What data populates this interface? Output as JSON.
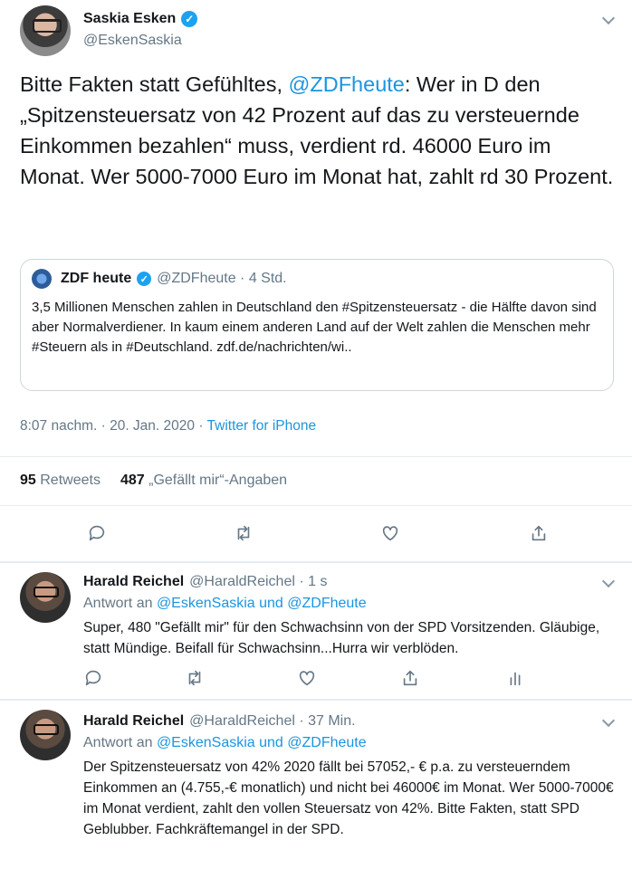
{
  "main_tweet": {
    "author_name": "Saskia Esken",
    "author_handle": "@EskenSaskia",
    "text_before_mention": "Bitte Fakten statt Gefühltes, ",
    "mention": "@ZDFheute",
    "text_after_mention": ": Wer in D den „Spitzensteuersatz von 42 Prozent auf das zu versteuernde Einkommen bezahlen“ muss, verdient rd. 46000 Euro im Monat. Wer 5000-7000 Euro im Monat hat, zahlt rd 30 Prozent.",
    "quoted": {
      "name": "ZDF heute",
      "handle_time": "@ZDFheute · 4 Std.",
      "text": "3,5 Millionen Menschen zahlen in Deutschland den #Spitzensteuersatz - die Hälfte davon sind aber Normalverdiener. In kaum einem anderen Land  auf der Welt zahlen die Menschen mehr #Steuern als in #Deutschland. zdf.de/nachrichten/wi.."
    },
    "timestamp": "8:07 nachm. · 20. Jan. 2020 · ",
    "source": "Twitter for iPhone",
    "retweets_count": "95",
    "retweets_label": "Retweets",
    "likes_count": "487",
    "likes_label": "„Gefällt mir“-Angaben",
    "verified_mark": "✓"
  },
  "icons": [
    "reply-icon",
    "retweet-icon",
    "like-icon",
    "share-icon",
    "analytics-icon",
    "chevron-down-icon",
    "verified-icon"
  ],
  "replies": [
    {
      "author_name": "Harald Reichel",
      "handle_time": "@HaraldReichel · 1 s",
      "reply_to_prefix": "Antwort an ",
      "reply_to_targets": "@EskenSaskia und @ZDFheute",
      "text": "Super, 480 \"Gefällt mir\" für den Schwachsinn von der SPD Vorsitzenden. Gläubige, statt Mündige. Beifall für Schwachsinn...Hurra wir verblöden."
    },
    {
      "author_name": "Harald Reichel",
      "handle_time": "@HaraldReichel · 37 Min.",
      "reply_to_prefix": "Antwort an ",
      "reply_to_targets": "@EskenSaskia und @ZDFheute",
      "text": "Der Spitzensteuersatz von 42% 2020 fällt bei 57052,- € p.a. zu versteuerndem Einkommen an (4.755,-€ monatlich) und nicht bei 46000€ im Monat. Wer 5000-7000€ im Monat verdient, zahlt den vollen Steuersatz von 42%. Bitte Fakten, statt SPD Geblubber. Fachkräftemangel in der SPD."
    }
  ],
  "colors": {
    "link": "#1b95e0",
    "muted": "#657786",
    "border": "#e6ecf0",
    "icon": "#657786",
    "verified": "#1da1f2"
  }
}
